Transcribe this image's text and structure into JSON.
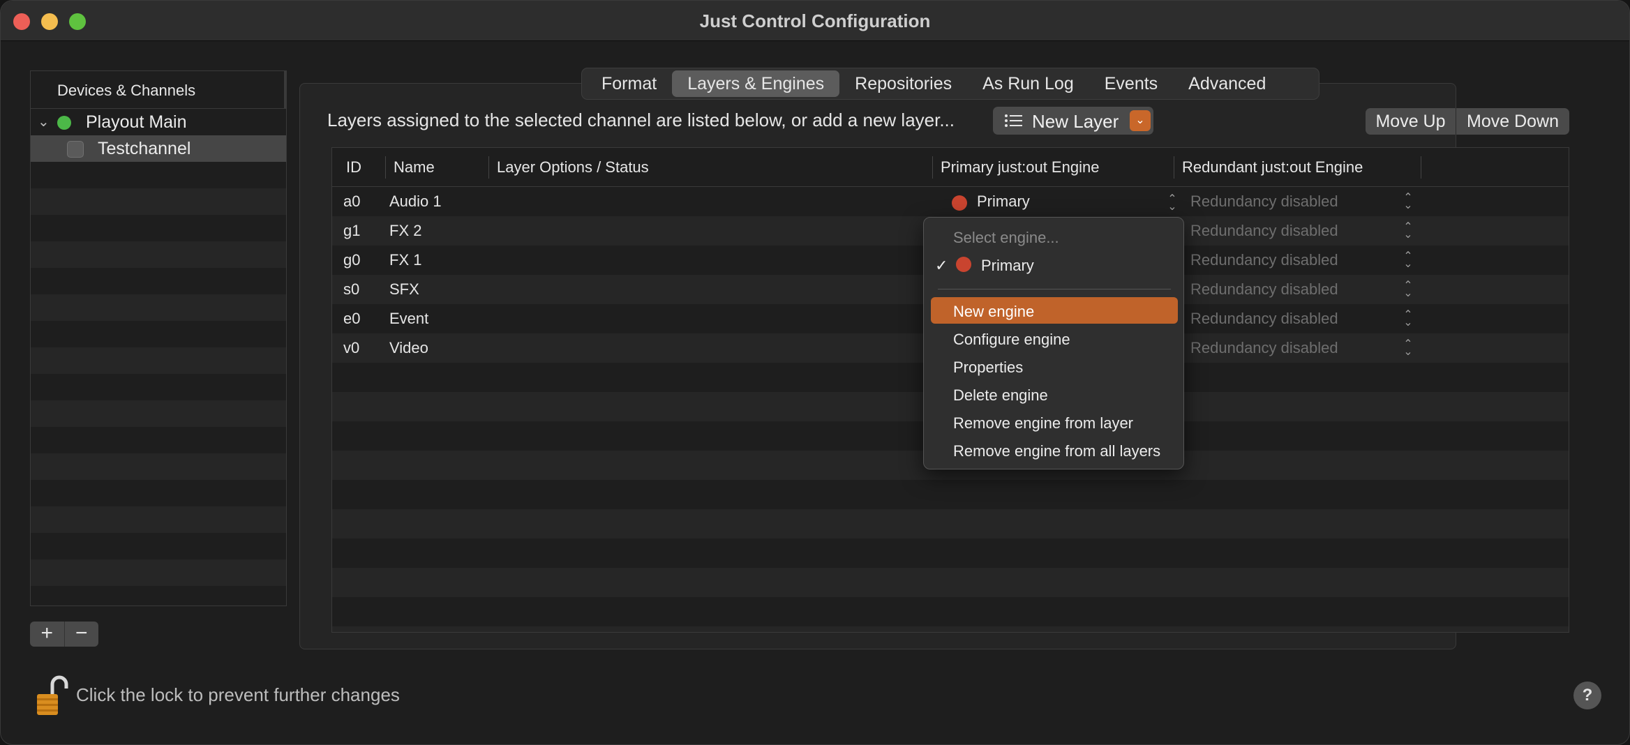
{
  "window": {
    "title": "Just Control Configuration"
  },
  "sidebar": {
    "header": "Devices & Channels",
    "items": [
      {
        "label": "Playout Main",
        "status_color": "#4cb848"
      },
      {
        "label": "Testchannel"
      }
    ]
  },
  "tabs": [
    {
      "label": "Format"
    },
    {
      "label": "Layers & Engines",
      "active": true
    },
    {
      "label": "Repositories"
    },
    {
      "label": "As Run Log"
    },
    {
      "label": "Events"
    },
    {
      "label": "Advanced"
    }
  ],
  "toolbar": {
    "info_text": "Layers assigned to the selected channel are listed below, or add a new layer...",
    "new_layer_label": "New Layer",
    "move_up_label": "Move Up",
    "move_down_label": "Move Down"
  },
  "table": {
    "columns": [
      "ID",
      "Name",
      "Layer Options / Status",
      "Primary just:out Engine",
      "Redundant just:out Engine"
    ],
    "rows": [
      {
        "id": "a0",
        "name": "Audio 1",
        "primary": "Primary",
        "redundant": "Redundancy disabled"
      },
      {
        "id": "g1",
        "name": "FX 2",
        "redundant": "Redundancy disabled"
      },
      {
        "id": "g0",
        "name": "FX 1",
        "redundant": "Redundancy disabled"
      },
      {
        "id": "s0",
        "name": "SFX",
        "redundant": "Redundancy disabled"
      },
      {
        "id": "e0",
        "name": "Event",
        "redundant": "Redundancy disabled"
      },
      {
        "id": "v0",
        "name": "Video",
        "redundant": "Redundancy disabled"
      }
    ]
  },
  "engine_menu": {
    "placeholder": "Select engine...",
    "selected": "Primary",
    "actions": [
      "New engine",
      "Configure engine",
      "Properties",
      "Delete engine",
      "Remove engine from layer",
      "Remove engine from all layers"
    ],
    "highlight_color": "#c0632a"
  },
  "footer": {
    "lock_text": "Click the lock to prevent further changes",
    "help_label": "?",
    "add_label": "+",
    "remove_label": "−"
  },
  "colors": {
    "accent": "#c9672a",
    "engine_status": "#c9442f",
    "channel_active": "#4cb848"
  }
}
